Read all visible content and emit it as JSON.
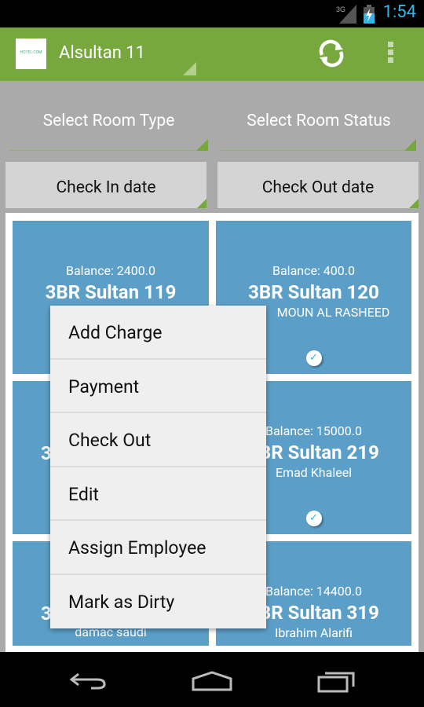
{
  "status_bar": {
    "network": "3G",
    "time": "1:54"
  },
  "action_bar": {
    "title": "Alsultan 11",
    "logo_text": "HOTEL.COM",
    "icons": [
      "refresh-icon",
      "overflow-menu-icon"
    ]
  },
  "filters": {
    "room_type": "Select Room Type",
    "room_status": "Select Room Status",
    "check_in": "Check In date",
    "check_out": "Check Out date"
  },
  "rooms": [
    {
      "balance": "Balance: 2400.0",
      "name": "3BR Sultan 119",
      "guest": ""
    },
    {
      "balance": "Balance: 400.0",
      "name": "3BR Sultan 120",
      "guest": "MOUN AL RASHEED",
      "checked": true
    },
    {
      "balance": "",
      "name": "3",
      "guest": ""
    },
    {
      "balance": "Balance: 15000.0",
      "name": "3BR Sultan 219",
      "guest": "Emad Khaleel",
      "checked": true
    },
    {
      "balance": "",
      "name": "3",
      "guest": "damac saudi"
    },
    {
      "balance": "Balance: 14400.0",
      "name": "3BR Sultan 319",
      "guest": "Ibrahim Alarifi"
    }
  ],
  "context_menu": {
    "items": [
      "Add Charge",
      "Payment",
      "Check Out",
      "Edit",
      "Assign Employee",
      "Mark as Dirty"
    ]
  },
  "colors": {
    "accent": "#76a83e",
    "tile": "#5b9fc8",
    "clock": "#33b5e5"
  }
}
